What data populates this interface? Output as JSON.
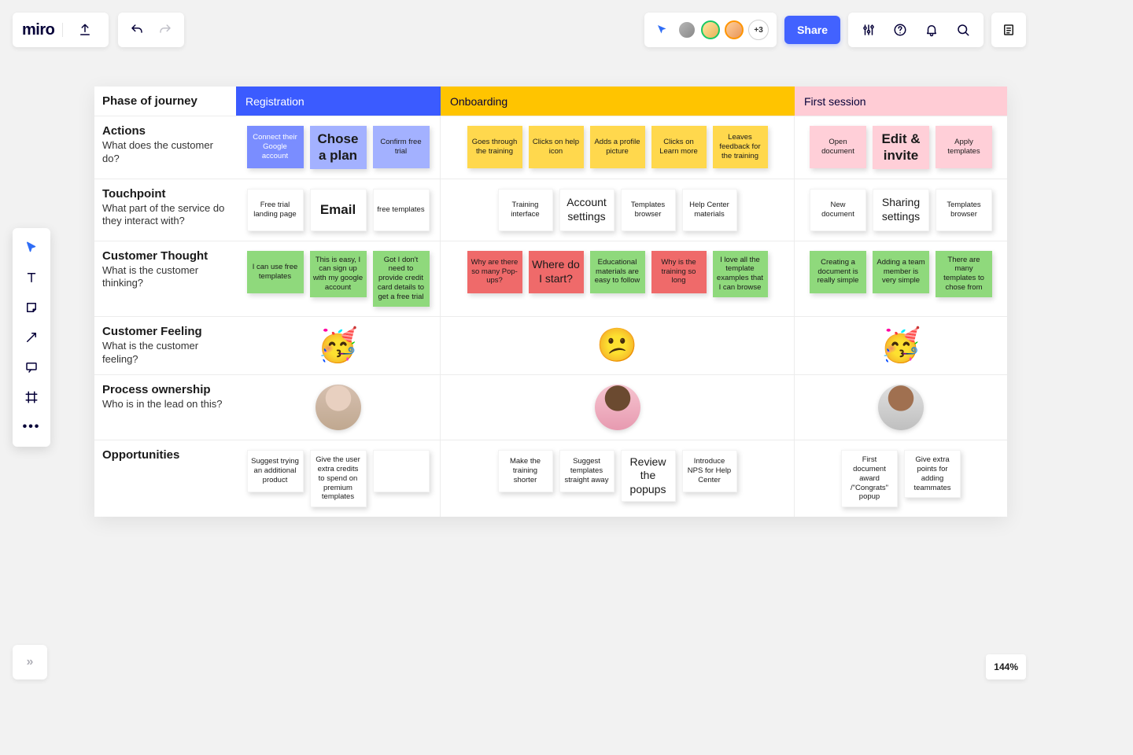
{
  "brand": "miro",
  "topbar": {
    "share": "Share",
    "more_avatars": "+3"
  },
  "zoom": "144%",
  "palette": [
    "select",
    "text",
    "sticky",
    "arrow",
    "comment",
    "frame",
    "more"
  ],
  "table": {
    "header_label": "Phase of journey",
    "phases": [
      "Registration",
      "Onboarding",
      "First session"
    ],
    "rows": [
      {
        "title": "Actions",
        "sub": "What does the customer do?"
      },
      {
        "title": "Touchpoint",
        "sub": "What part of the service do they interact with?"
      },
      {
        "title": "Customer Thought",
        "sub": "What is the customer thinking?"
      },
      {
        "title": "Customer Feeling",
        "sub": "What is the customer feeling?"
      },
      {
        "title": "Process ownership",
        "sub": "Who is in the lead on this?"
      },
      {
        "title": "Opportunities",
        "sub": ""
      }
    ],
    "actions": {
      "reg": [
        {
          "t": "Connect their Google account",
          "c": "c-blue"
        },
        {
          "t": "Chose a plan",
          "c": "c-bluel",
          "size": "huge"
        },
        {
          "t": "Confirm free trial",
          "c": "c-bluel"
        }
      ],
      "onb": [
        {
          "t": "Goes through the training",
          "c": "c-yellow"
        },
        {
          "t": "Clicks on help icon",
          "c": "c-yellow"
        },
        {
          "t": "Adds a profile picture",
          "c": "c-yellow"
        },
        {
          "t": "Clicks on Learn more",
          "c": "c-yellow"
        },
        {
          "t": "Leaves feedback for the training",
          "c": "c-yellow"
        }
      ],
      "fs": [
        {
          "t": "Open document",
          "c": "c-pink"
        },
        {
          "t": "Edit & invite",
          "c": "c-pink",
          "size": "huge"
        },
        {
          "t": "Apply templates",
          "c": "c-pink"
        }
      ]
    },
    "touch": {
      "reg": [
        {
          "t": "Free trial landing page",
          "c": "c-grey"
        },
        {
          "t": "Email",
          "c": "c-grey",
          "size": "huge"
        },
        {
          "t": "free templates",
          "c": "c-grey"
        }
      ],
      "onb": [
        {
          "t": "Training interface",
          "c": "c-grey"
        },
        {
          "t": "Account settings",
          "c": "c-grey",
          "size": "big"
        },
        {
          "t": "Templates browser",
          "c": "c-grey"
        },
        {
          "t": "Help Center materials",
          "c": "c-grey"
        }
      ],
      "fs": [
        {
          "t": "New document",
          "c": "c-grey"
        },
        {
          "t": "Sharing settings",
          "c": "c-grey",
          "size": "big"
        },
        {
          "t": "Templates browser",
          "c": "c-grey"
        }
      ]
    },
    "thought": {
      "reg": [
        {
          "t": "I can use free templates",
          "c": "c-green"
        },
        {
          "t": "This is easy, I can sign up with my google account",
          "c": "c-green"
        },
        {
          "t": "Got I don't need to provide credit card details to get a free trial",
          "c": "c-green"
        }
      ],
      "onb": [
        {
          "t": "Why are there so many Pop-ups?",
          "c": "c-red"
        },
        {
          "t": "Where do I start?",
          "c": "c-red",
          "size": "big"
        },
        {
          "t": "Educational materials are easy to follow",
          "c": "c-green"
        },
        {
          "t": "Why is the training so long",
          "c": "c-red"
        },
        {
          "t": "I love all the template examples that I can browse",
          "c": "c-green"
        }
      ],
      "fs": [
        {
          "t": "Creating a document is really simple",
          "c": "c-green"
        },
        {
          "t": "Adding a team member is very simple",
          "c": "c-green"
        },
        {
          "t": "There are many templates to chose from",
          "c": "c-green"
        }
      ]
    },
    "feeling": {
      "reg": "🥳",
      "onb": "😕",
      "fs": "🥳"
    },
    "opps": {
      "reg": [
        {
          "t": "Suggest trying an additional product",
          "c": "c-grey"
        },
        {
          "t": "Give the user extra credits to spend on premium templates",
          "c": "c-grey"
        },
        {
          "t": "",
          "c": "c-grey"
        }
      ],
      "onb": [
        {
          "t": "Make the training shorter",
          "c": "c-grey"
        },
        {
          "t": "Suggest templates straight away",
          "c": "c-grey"
        },
        {
          "t": "Review the popups",
          "c": "c-grey",
          "size": "big"
        },
        {
          "t": "Introduce NPS for Help Center",
          "c": "c-grey"
        }
      ],
      "fs": [
        {
          "t": "First document award /\"Congrats\" popup",
          "c": "c-grey"
        },
        {
          "t": "Give extra points for adding teammates",
          "c": "c-grey"
        }
      ]
    }
  }
}
